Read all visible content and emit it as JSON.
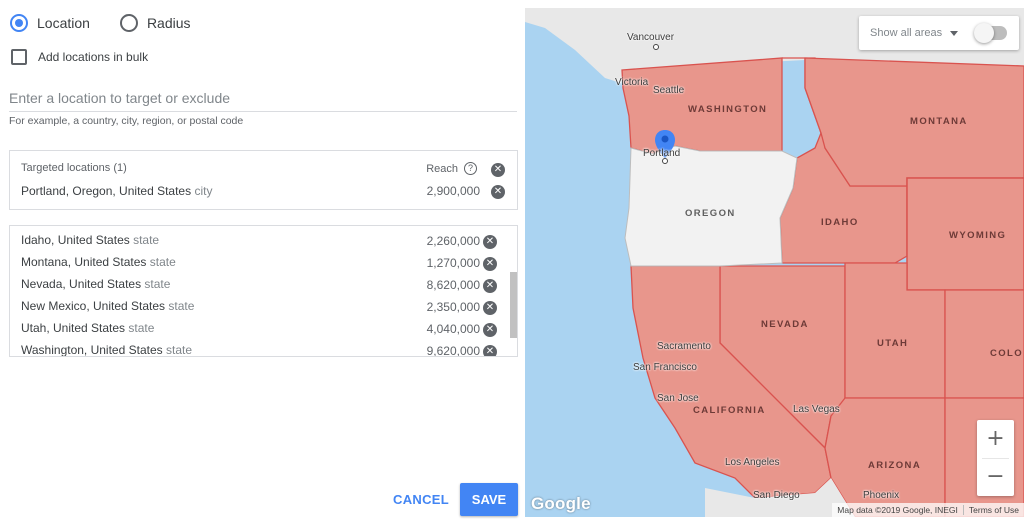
{
  "target_mode": {
    "location_label": "Location",
    "radius_label": "Radius",
    "selected": "Location"
  },
  "bulk": {
    "label": "Add locations in bulk",
    "checked": false
  },
  "search": {
    "placeholder": "Enter a location to target or exclude",
    "hint": "For example, a country, city, region, or postal code"
  },
  "targeted": {
    "header": "Targeted locations (1)",
    "reach_label": "Reach",
    "help_glyph": "?",
    "items": [
      {
        "name": "Portland, Oregon, United States",
        "type": "city",
        "reach": "2,900,000"
      }
    ]
  },
  "excluded": {
    "items": [
      {
        "name": "Idaho, United States",
        "type": "state",
        "reach": "2,260,000"
      },
      {
        "name": "Montana, United States",
        "type": "state",
        "reach": "1,270,000"
      },
      {
        "name": "Nevada, United States",
        "type": "state",
        "reach": "8,620,000"
      },
      {
        "name": "New Mexico, United States",
        "type": "state",
        "reach": "2,350,000"
      },
      {
        "name": "Utah, United States",
        "type": "state",
        "reach": "4,040,000"
      },
      {
        "name": "Washington, United States",
        "type": "state",
        "reach": "9,620,000"
      }
    ]
  },
  "actions": {
    "cancel_label": "CANCEL",
    "save_label": "SAVE"
  },
  "map": {
    "show_areas_label": "Show all areas",
    "show_areas_on": false,
    "zoom_in_glyph": "+",
    "zoom_out_glyph": "−",
    "logo_text": "Google",
    "attribution": "Map data ©2019 Google, INEGI",
    "terms": "Terms of Use",
    "colors": {
      "water": "#aad3f1",
      "excluded": "#e8968c",
      "border": "#d9534f",
      "targeted": "#f2f2f2",
      "land": "#e8e8e8",
      "pin": "#4285f4"
    },
    "states": {
      "washington": "WASHINGTON",
      "oregon": "OREGON",
      "idaho": "IDAHO",
      "montana": "MONTANA",
      "wyoming": "WYOMING",
      "nevada": "NEVADA",
      "utah": "UTAH",
      "california": "CALIFORNIA",
      "arizona": "ARIZONA",
      "colorado": "COLO"
    },
    "cities": {
      "vancouver": "Vancouver",
      "victoria": "Victoria",
      "seattle": "Seattle",
      "portland": "Portland",
      "sacramento": "Sacramento",
      "san_francisco": "San Francisco",
      "san_jose": "San Jose",
      "las_vegas": "Las Vegas",
      "los_angeles": "Los Angeles",
      "san_diego": "San Diego",
      "phoenix": "Phoenix"
    }
  }
}
